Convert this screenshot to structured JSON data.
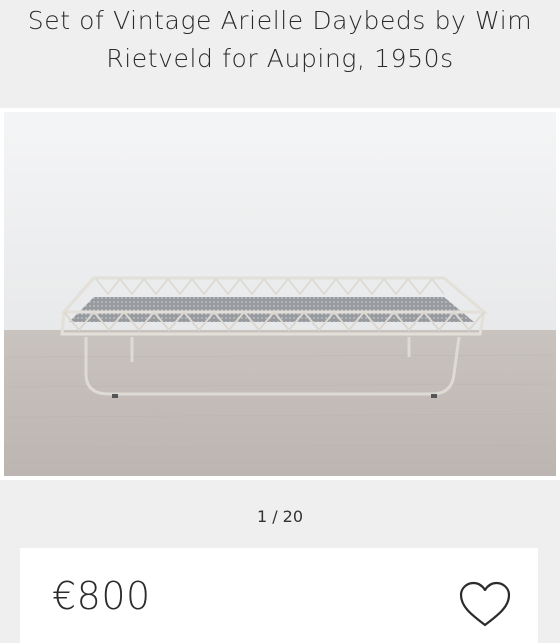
{
  "product": {
    "title_line1": "Set of Vintage Arielle Daybeds by Wim",
    "title_line2": "Rietveld for Auping, 1950s"
  },
  "gallery": {
    "counter": "1 / 20",
    "image_alt": "Daybed photo"
  },
  "pricing": {
    "price": "€800"
  },
  "icons": {
    "favorite": "heart-icon"
  },
  "colors": {
    "background": "#efefef",
    "card": "#ffffff",
    "text": "#2b2b2b"
  }
}
